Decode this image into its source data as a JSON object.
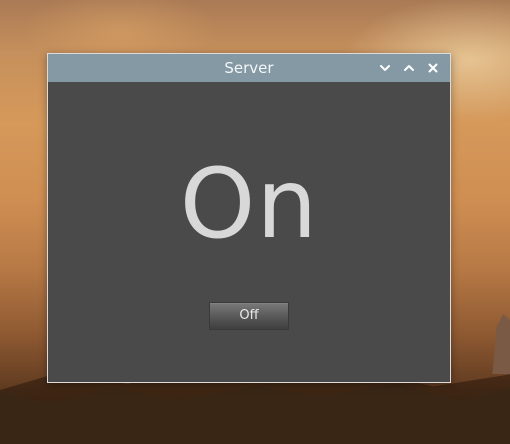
{
  "window": {
    "title": "Server",
    "controls": {
      "minimize_icon": "chevron-down-icon",
      "maximize_icon": "chevron-up-icon",
      "close_icon": "close-icon"
    }
  },
  "main": {
    "status_text": "On",
    "toggle_button_label": "Off"
  },
  "colors": {
    "titlebar": "#8499a4",
    "window_body": "#4a4a4a",
    "status_text": "#d8d8d8"
  }
}
